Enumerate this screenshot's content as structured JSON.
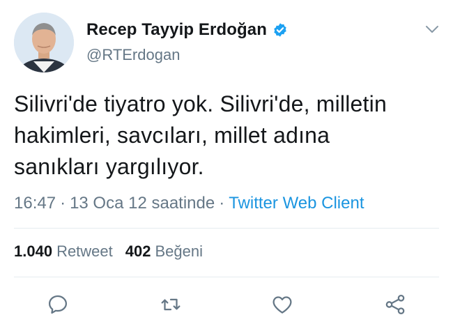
{
  "author": {
    "display_name": "Recep Tayyip Erdoğan",
    "handle": "@RTErdogan",
    "verified": true
  },
  "tweet": {
    "lines": [
      "Silivri'de tiyatro yok. Silivri'de, milletin",
      "hakimleri, savcıları, millet adına",
      "sanıkları yargılıyor."
    ]
  },
  "meta": {
    "time": "16:47",
    "separator": "·",
    "date": "13 Oca 12 saatinde",
    "client": "Twitter Web Client"
  },
  "stats": {
    "retweets": {
      "count": "1.040",
      "label": "Retweet"
    },
    "likes": {
      "count": "402",
      "label": "Beğeni"
    }
  },
  "icons": {
    "verified": "verified-badge-icon",
    "menu": "chevron-down-icon",
    "reply": "reply-icon",
    "retweet": "retweet-icon",
    "like": "heart-icon",
    "share": "share-icon"
  },
  "colors": {
    "text": "#14171a",
    "secondary": "#657786",
    "link": "#1b95e0",
    "verified": "#1da1f2",
    "divider": "#e6ecf0"
  }
}
